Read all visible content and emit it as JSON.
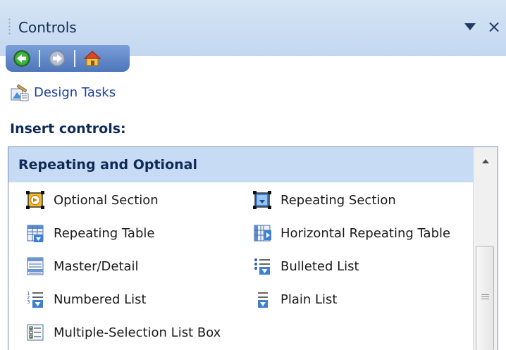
{
  "pane": {
    "title": "Controls",
    "menu_icon": "triangle-down-icon",
    "close_label": "×"
  },
  "nav": {
    "back_icon": "back-arrow-icon",
    "forward_icon": "forward-arrow-icon",
    "home_icon": "home-icon"
  },
  "design_tasks": {
    "label": "Design Tasks",
    "icon": "design-tasks-icon"
  },
  "insert_controls": {
    "heading": "Insert controls:",
    "group_header": "Repeating and Optional",
    "items": [
      {
        "label": "Optional Section",
        "icon": "optional-section-icon"
      },
      {
        "label": "Repeating Section",
        "icon": "repeating-section-icon"
      },
      {
        "label": "Repeating Table",
        "icon": "repeating-table-icon"
      },
      {
        "label": "Horizontal Repeating Table",
        "icon": "horizontal-repeating-table-icon"
      },
      {
        "label": "Master/Detail",
        "icon": "master-detail-icon"
      },
      {
        "label": "Bulleted List",
        "icon": "bulleted-list-icon"
      },
      {
        "label": "Numbered List",
        "icon": "numbered-list-icon"
      },
      {
        "label": "Plain List",
        "icon": "plain-list-icon"
      },
      {
        "label": "Multiple-Selection List Box",
        "icon": "multiple-selection-list-box-icon"
      }
    ]
  },
  "colors": {
    "title_bar": "#c3d8f0",
    "nav_bar": "#4e76bb",
    "group_header": "#c7dbf4",
    "link_text": "#1d3fa3"
  }
}
